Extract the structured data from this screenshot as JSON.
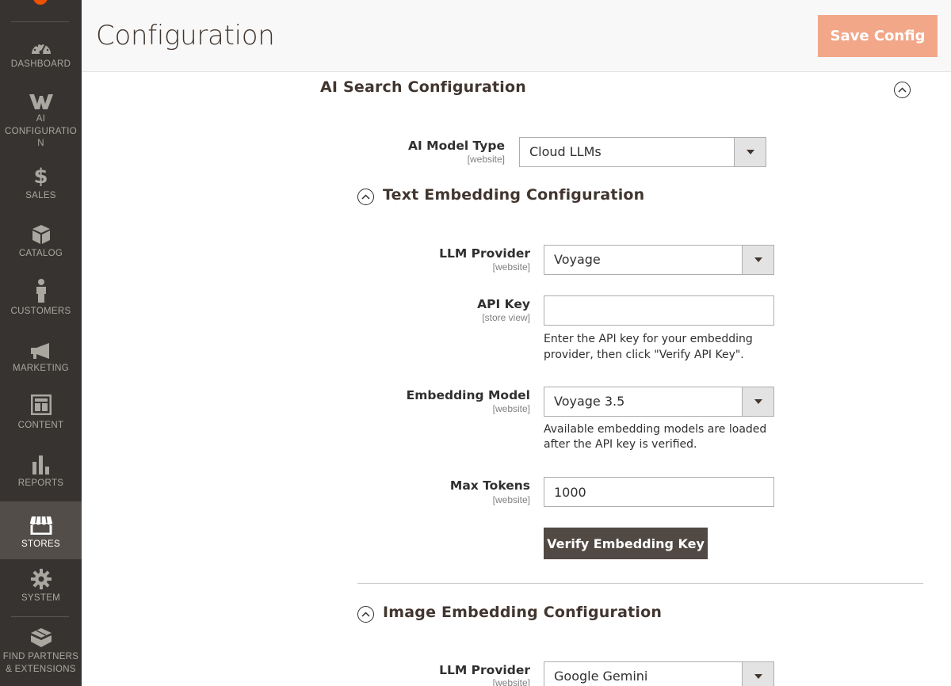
{
  "sidebar": {
    "items": [
      {
        "label": "DASHBOARD",
        "icon": "dashboard-icon"
      },
      {
        "label": "AI CONFIGURATIO N",
        "icon": "ai-logo-icon"
      },
      {
        "label": "SALES",
        "icon": "dollar-icon"
      },
      {
        "label": "CATALOG",
        "icon": "cube-icon"
      },
      {
        "label": "CUSTOMERS",
        "icon": "person-icon"
      },
      {
        "label": "MARKETING",
        "icon": "megaphone-icon"
      },
      {
        "label": "CONTENT",
        "icon": "layout-icon"
      },
      {
        "label": "REPORTS",
        "icon": "bar-chart-icon"
      },
      {
        "label": "STORES",
        "icon": "storefront-icon"
      },
      {
        "label": "SYSTEM",
        "icon": "gear-icon"
      },
      {
        "label": "FIND PARTNERS & EXTENSIONS",
        "icon": "blocks-icon"
      }
    ],
    "active": "STORES"
  },
  "header": {
    "title": "Configuration",
    "save_label": "Save Config"
  },
  "section": {
    "title": "AI Search Configuration",
    "ai_model_type": {
      "label": "AI Model Type",
      "scope": "[website]",
      "value": "Cloud LLMs"
    }
  },
  "text_embedding": {
    "title": "Text Embedding Configuration",
    "llm_provider": {
      "label": "LLM Provider",
      "scope": "[website]",
      "value": "Voyage"
    },
    "api_key": {
      "label": "API Key",
      "scope": "[store view]",
      "value": "",
      "note": "Enter the API key for your embedding provider, then click \"Verify API Key\"."
    },
    "embedding_model": {
      "label": "Embedding Model",
      "scope": "[website]",
      "value": "Voyage 3.5",
      "note": "Available embedding models are loaded after the API key is verified."
    },
    "max_tokens": {
      "label": "Max Tokens",
      "scope": "[website]",
      "value": "1000"
    },
    "verify_label": "Verify Embedding Key"
  },
  "image_embedding": {
    "title": "Image Embedding Configuration",
    "llm_provider": {
      "label": "LLM Provider",
      "scope": "[website]",
      "value": "Google Gemini"
    }
  },
  "colors": {
    "sidebar_bg": "#373330",
    "sidebar_active": "#524d49",
    "save_button": "#f2a789",
    "verify_button": "#514943",
    "brand_logo": "#eb5202"
  }
}
